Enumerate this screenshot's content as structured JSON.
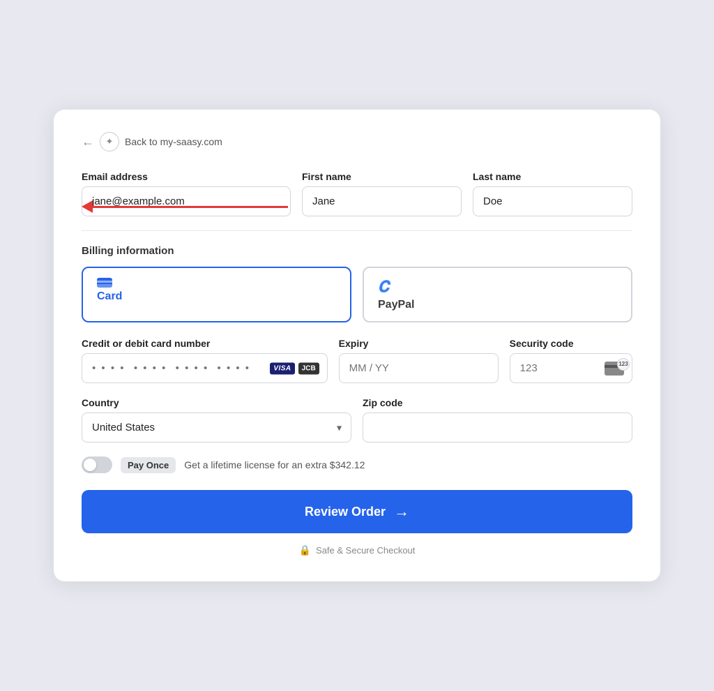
{
  "header": {
    "back_arrow": "←",
    "back_label": "Back to my-saasy.com",
    "logo_symbol": "✦"
  },
  "form": {
    "email_label": "Email address",
    "email_value": "jane@example.com",
    "firstname_label": "First name",
    "firstname_value": "Jane",
    "lastname_label": "Last name",
    "lastname_value": "Doe"
  },
  "billing": {
    "section_title": "Billing information",
    "card_label": "Card",
    "paypal_label": "PayPal",
    "card_number_label": "Credit or debit card number",
    "card_number_placeholder": "• • • •  • • • •  • • • •  • • • •",
    "expiry_label": "Expiry",
    "expiry_placeholder": "MM / YY",
    "security_label": "Security code",
    "security_placeholder": "123",
    "country_label": "Country",
    "country_value": "United States",
    "zipcode_label": "Zip code",
    "zipcode_placeholder": ""
  },
  "toggle": {
    "pay_once_badge": "Pay Once",
    "pay_once_text": "Get a lifetime license for an extra $342.12"
  },
  "review_button": {
    "label": "Review Order",
    "arrow": "→"
  },
  "secure": {
    "label": "Safe & Secure Checkout"
  }
}
